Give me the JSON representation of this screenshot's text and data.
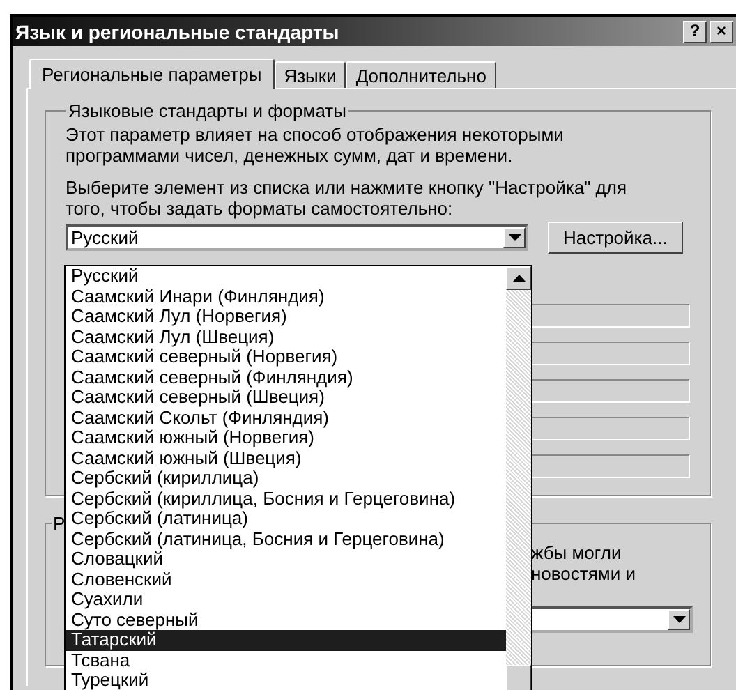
{
  "window": {
    "title": "Язык и региональные стандарты",
    "buttons": [
      "?",
      "×"
    ]
  },
  "tabs": [
    {
      "label": "Региональные параметры",
      "selected": true
    },
    {
      "label": "Языки",
      "selected": false
    },
    {
      "label": "Дополнительно",
      "selected": false
    }
  ],
  "language_group": {
    "label": "Языковые стандарты и форматы",
    "description": "Этот параметр влияет на способ отображения некоторыми программами чисел, денежных сумм, дат и времени.",
    "instruction": "Выберите элемент из списка или нажмите кнопку \"Настройка\" для того, чтобы задать форматы самостоятельно:",
    "combo_value": "Русский",
    "button": "Настройка..."
  },
  "dropdown_list": {
    "items": [
      {
        "label": "Русский",
        "selected": false
      },
      {
        "label": "Саамский Инари (Финляндия)",
        "selected": false
      },
      {
        "label": "Саамский Лул (Норвегия)",
        "selected": false
      },
      {
        "label": "Саамский Лул (Швеция)",
        "selected": false
      },
      {
        "label": "Саамский северный (Норвегия)",
        "selected": false
      },
      {
        "label": "Саамский северный (Финляндия)",
        "selected": false
      },
      {
        "label": "Саамский северный (Швеция)",
        "selected": false
      },
      {
        "label": "Саамский Скольт (Финляндия)",
        "selected": false
      },
      {
        "label": "Саамский южный (Норвегия)",
        "selected": false
      },
      {
        "label": "Саамский южный (Швеция)",
        "selected": false
      },
      {
        "label": "Сербский (кириллица)",
        "selected": false
      },
      {
        "label": "Сербский (кириллица, Босния и Герцеговина)",
        "selected": false
      },
      {
        "label": "Сербский (латиница)",
        "selected": false
      },
      {
        "label": "Сербский (латиница, Босния и Герцеговина)",
        "selected": false
      },
      {
        "label": "Словацкий",
        "selected": false
      },
      {
        "label": "Словенский",
        "selected": false
      },
      {
        "label": "Суахили",
        "selected": false
      },
      {
        "label": "Суто северный",
        "selected": false
      },
      {
        "label": "Татарский",
        "selected": true
      },
      {
        "label": "Тсвана",
        "selected": false
      },
      {
        "label": "Турецкий",
        "selected": false
      }
    ]
  },
  "location_group": {
    "label": "Р",
    "text_lines": [
      "жбы могли",
      "новостями и"
    ]
  }
}
